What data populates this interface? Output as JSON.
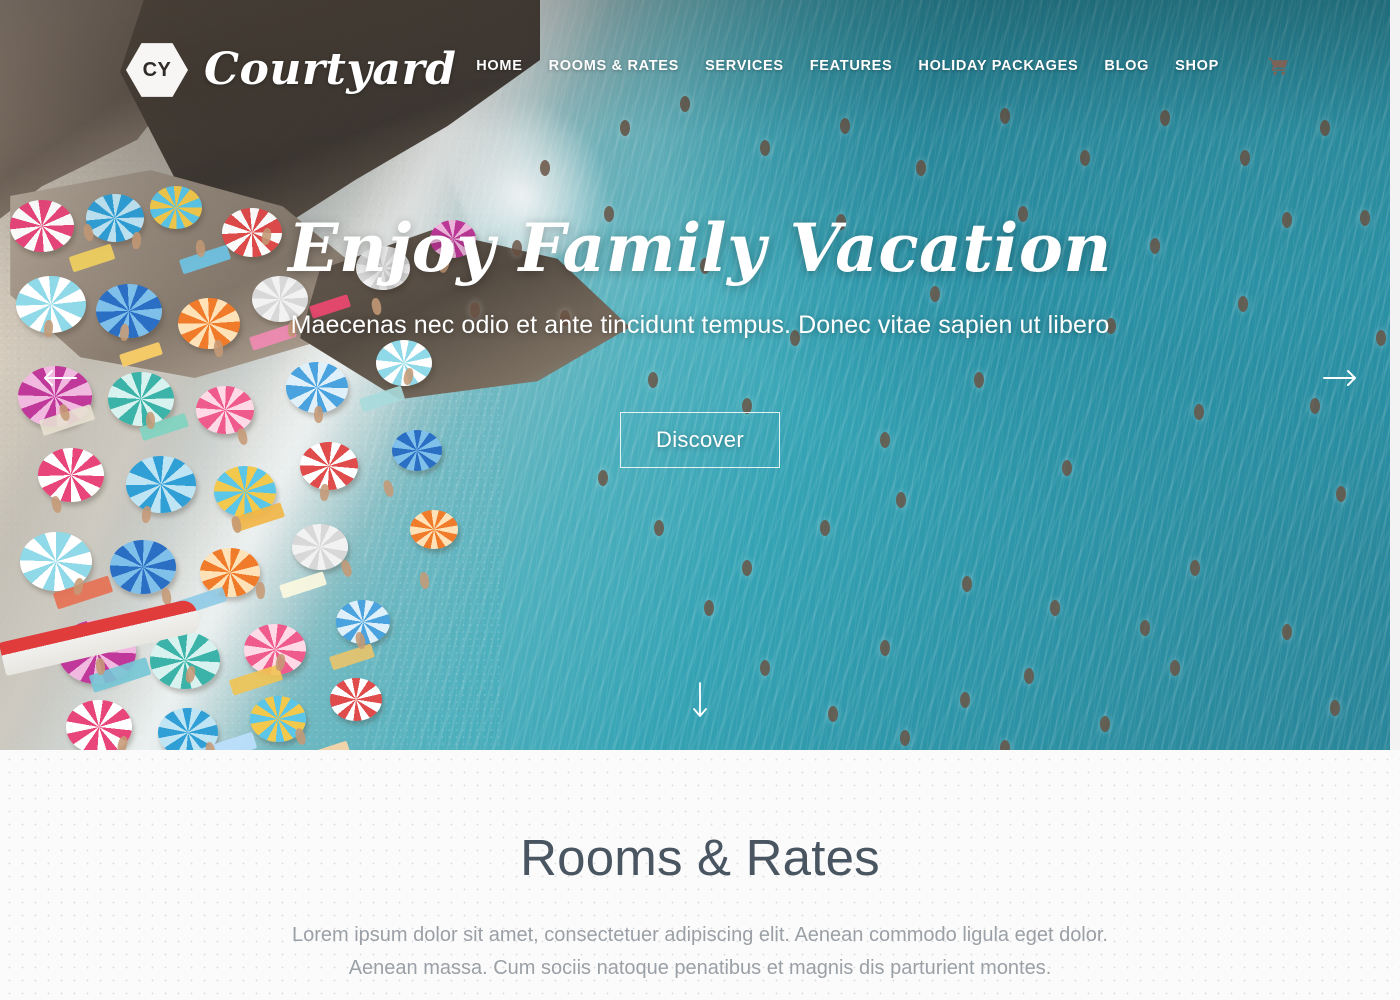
{
  "brand": {
    "logo_text": "CY",
    "logo_icon": "hexagon-icon",
    "name": "Courtyard"
  },
  "nav": {
    "items": [
      {
        "label": "HOME"
      },
      {
        "label": "ROOMS & RATES"
      },
      {
        "label": "SERVICES"
      },
      {
        "label": "FEATURES"
      },
      {
        "label": "HOLIDAY PACKAGES"
      },
      {
        "label": "BLOG"
      },
      {
        "label": "SHOP"
      }
    ],
    "cart_icon": "shopping-cart-icon"
  },
  "hero": {
    "title": "Enjoy Family Vacation",
    "subtitle": "Maecenas nec odio et ante tincidunt tempus. Donec vitae sapien ut libero",
    "cta_label": "Discover",
    "prev_icon": "arrow-left-icon",
    "next_icon": "arrow-right-icon",
    "scroll_icon": "arrow-down-icon",
    "image_alt": "Aerial view of a crowded beach with colorful umbrellas and turquoise sea"
  },
  "rooms_section": {
    "title": "Rooms & Rates",
    "description_line_1": "Lorem ipsum dolor sit amet, consectetuer adipiscing elit. Aenean commodo ligula eget dolor.",
    "description_line_2": "Aenean massa. Cum sociis natoque penatibus et magnis dis parturient montes."
  },
  "colors": {
    "sea": "#2e96a9",
    "sand": "#d4c9ba",
    "text_light": "#ffffff",
    "heading_dark": "#4a5562",
    "body_gray": "#9aa0a6",
    "section_bg": "#fbfbfb",
    "cart_icon": "#7d6257"
  }
}
